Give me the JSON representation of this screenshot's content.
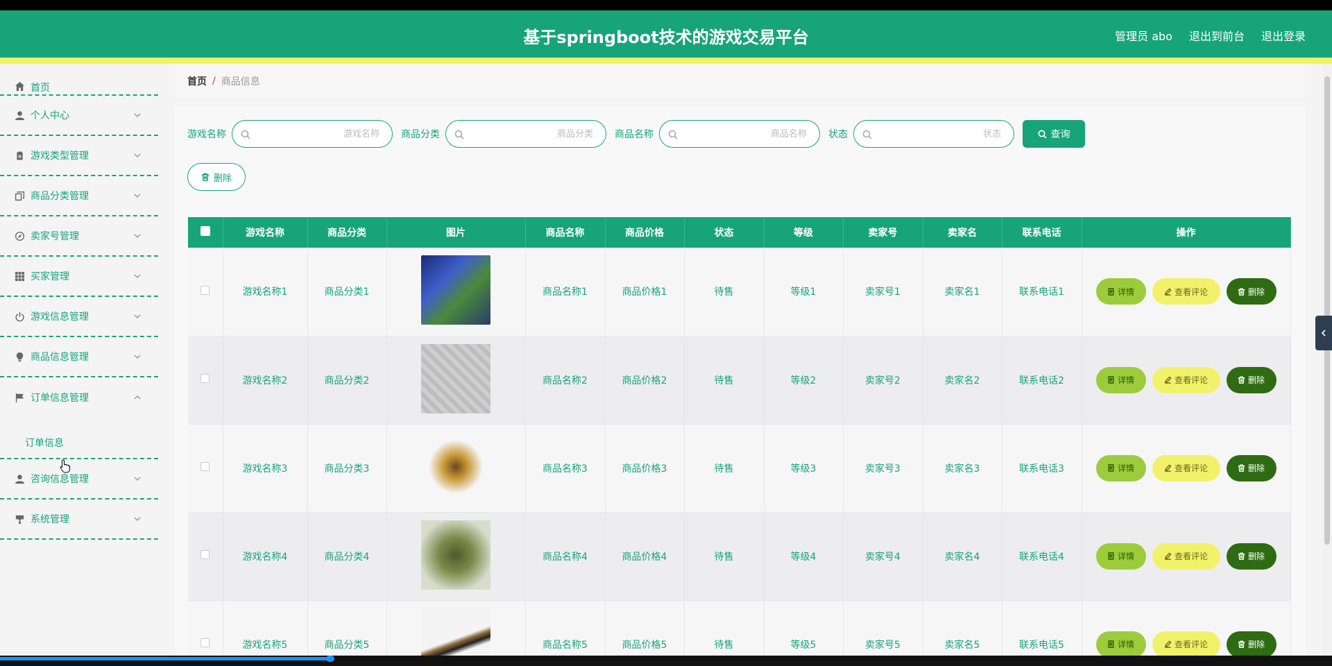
{
  "header": {
    "title": "基于springboot技术的游戏交易平台",
    "links": [
      "管理员 abo",
      "退出到前台",
      "退出登录"
    ]
  },
  "sidebar": {
    "items": [
      {
        "label": "首页",
        "icon": "home-icon"
      },
      {
        "label": "个人中心",
        "icon": "user-icon"
      },
      {
        "label": "游戏类型管理",
        "icon": "clipboard-icon"
      },
      {
        "label": "商品分类管理",
        "icon": "copy-icon"
      },
      {
        "label": "卖家号管理",
        "icon": "compass-icon"
      },
      {
        "label": "买家管理",
        "icon": "grid-icon"
      },
      {
        "label": "游戏信息管理",
        "icon": "power-icon"
      },
      {
        "label": "商品信息管理",
        "icon": "bulb-icon"
      },
      {
        "label": "订单信息管理",
        "icon": "flag-icon"
      },
      {
        "label": "咨询信息管理",
        "icon": "user-icon"
      },
      {
        "label": "系统管理",
        "icon": "stamp-icon"
      }
    ],
    "submenu": [
      "订单信息"
    ]
  },
  "breadcrumb": {
    "home": "首页",
    "sep": "/",
    "current": "商品信息"
  },
  "search": {
    "fields": [
      {
        "label": "游戏名称",
        "placeholder": "游戏名称"
      },
      {
        "label": "商品分类",
        "placeholder": "商品分类"
      },
      {
        "label": "商品名称",
        "placeholder": "商品名称"
      },
      {
        "label": "状态",
        "placeholder": "状态"
      }
    ],
    "query_label": "查询",
    "delete_label": "删除"
  },
  "table": {
    "columns": [
      "游戏名称",
      "商品分类",
      "图片",
      "商品名称",
      "商品价格",
      "状态",
      "等级",
      "卖家号",
      "卖家名",
      "联系电话",
      "操作"
    ],
    "rows": [
      [
        "游戏名称1",
        "商品分类1",
        "",
        "商品名称1",
        "商品价格1",
        "待售",
        "等级1",
        "卖家号1",
        "卖家名1",
        "联系电话1"
      ],
      [
        "游戏名称2",
        "商品分类2",
        "",
        "商品名称2",
        "商品价格2",
        "待售",
        "等级2",
        "卖家号2",
        "卖家名2",
        "联系电话2"
      ],
      [
        "游戏名称3",
        "商品分类3",
        "",
        "商品名称3",
        "商品价格3",
        "待售",
        "等级3",
        "卖家号3",
        "卖家名3",
        "联系电话3"
      ],
      [
        "游戏名称4",
        "商品分类4",
        "",
        "商品名称4",
        "商品价格4",
        "待售",
        "等级4",
        "卖家号4",
        "卖家名4",
        "联系电话4"
      ],
      [
        "游戏名称5",
        "商品分类5",
        "",
        "商品名称5",
        "商品价格5",
        "待售",
        "等级5",
        "卖家号5",
        "卖家名5",
        "联系电话5"
      ]
    ],
    "actions": {
      "detail": "详情",
      "comment": "查看评论",
      "delete": "删除"
    }
  },
  "colors": {
    "primary": "#17a479",
    "accent_yellow": "#f0f26a",
    "detail": "#9ccc3c",
    "delete": "#2e6b12"
  }
}
